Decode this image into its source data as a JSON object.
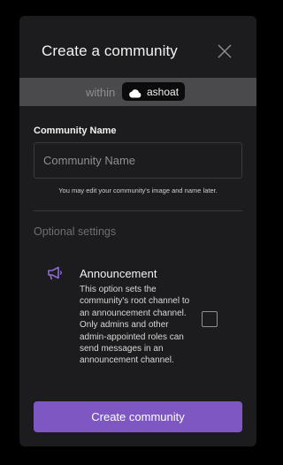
{
  "modal": {
    "title": "Create a community",
    "close_icon": "close-icon"
  },
  "within": {
    "label": "within",
    "icon": "cloud-icon",
    "keyserver": "ashoat"
  },
  "name_section": {
    "label": "Community Name",
    "placeholder": "Community Name",
    "value": "",
    "hint": "You may edit your community's image and name later."
  },
  "optional": {
    "label": "Optional settings"
  },
  "announcement": {
    "icon": "megaphone-icon",
    "title": "Announcement",
    "description": "This option sets the community's root channel to an announcement channel. Only admins and other admin-appointed roles can send messages in an announcement channel.",
    "checked": false
  },
  "actions": {
    "create_label": "Create community"
  },
  "colors": {
    "accent": "#7e57c2",
    "announcement_icon": "#8c6bd6",
    "background": "#1c1c1e"
  }
}
